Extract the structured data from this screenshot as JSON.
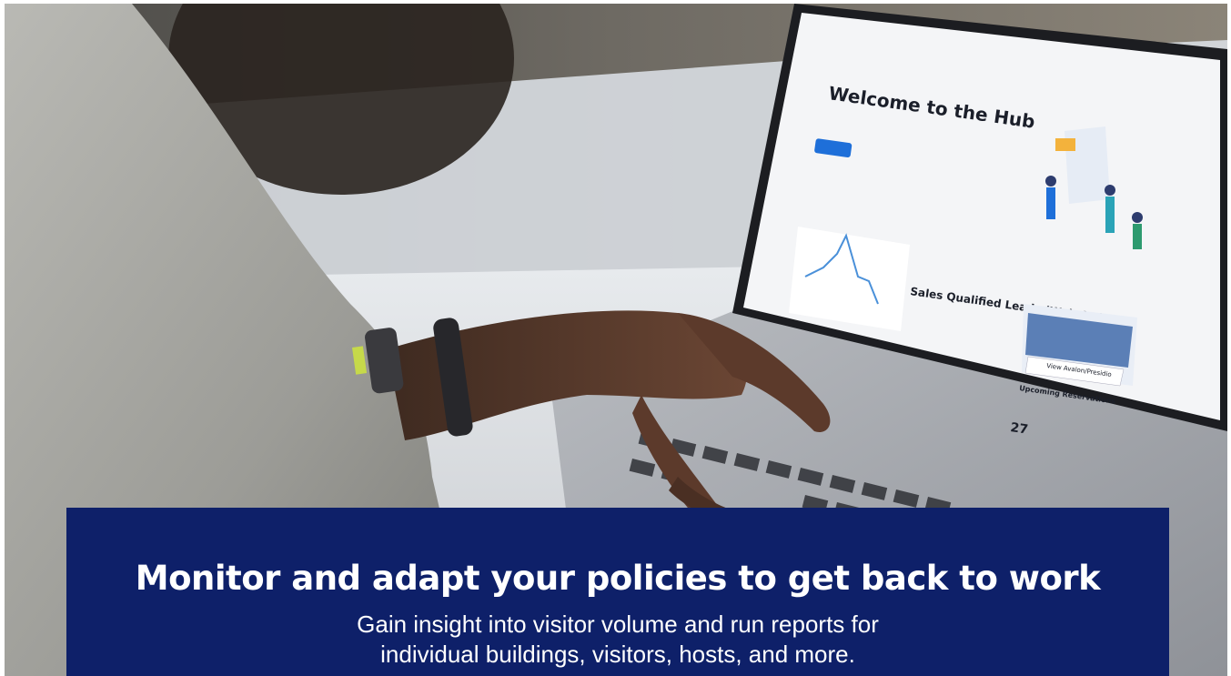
{
  "caption": {
    "headline": "Monitor and adapt your policies to get back to work",
    "line1": "Gain insight into visitor volume and run reports for",
    "line2": "individual buildings, visitors, hosts, and more."
  },
  "screen": {
    "welcome_title": "Welcome to the Hub",
    "lead_card_title": "Sales Qualified Leads (Website)",
    "view_button": "View Avalon/Presidio",
    "section_label": "Upcoming Reservations",
    "date_number": "27"
  },
  "colors": {
    "caption_bg": "#0e2069",
    "accent_blue": "#1e6fd9"
  }
}
